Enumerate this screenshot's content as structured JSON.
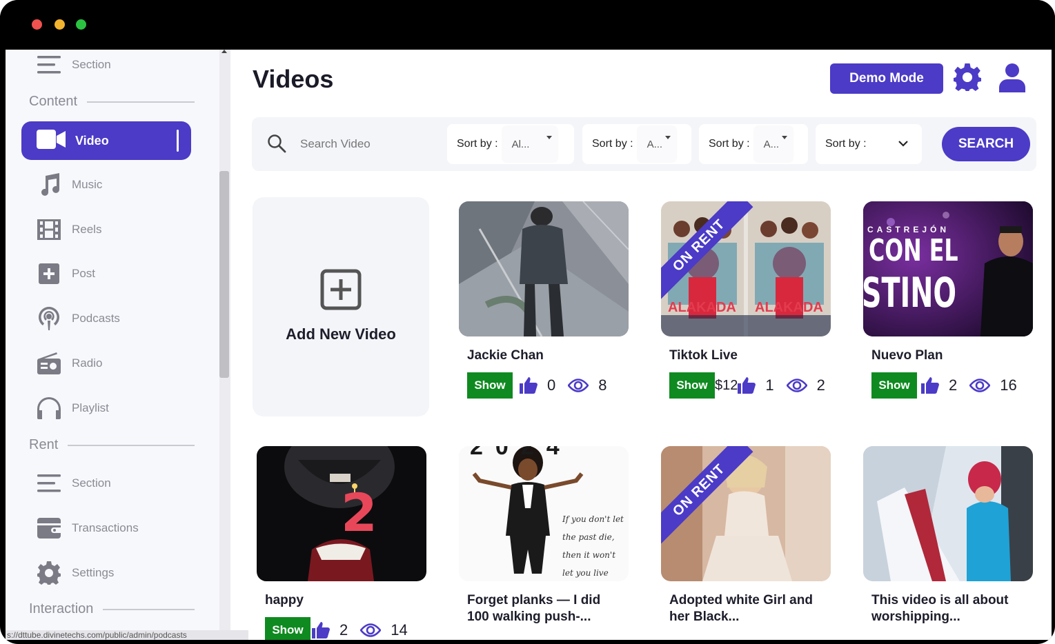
{
  "window": {
    "traffic_lights": [
      "close",
      "minimize",
      "zoom"
    ]
  },
  "colors": {
    "accent": "#4b3bc7",
    "show": "#0f8a20",
    "frame": "#000000"
  },
  "sidebar": {
    "top_item": {
      "label": "Section",
      "icon": "menu-icon"
    },
    "groups": [
      {
        "title": "Content"
      },
      {
        "title": "Rent"
      },
      {
        "title": "Interaction"
      }
    ],
    "content_items": [
      {
        "label": "Video",
        "icon": "video-camera-icon",
        "active": true
      },
      {
        "label": "Music",
        "icon": "music-note-icon"
      },
      {
        "label": "Reels",
        "icon": "film-icon"
      },
      {
        "label": "Post",
        "icon": "plus-square-icon"
      },
      {
        "label": "Podcasts",
        "icon": "podcast-icon"
      },
      {
        "label": "Radio",
        "icon": "radio-icon"
      },
      {
        "label": "Playlist",
        "icon": "headphones-icon"
      }
    ],
    "rent_items": [
      {
        "label": "Section",
        "icon": "menu-icon"
      },
      {
        "label": "Transactions",
        "icon": "wallet-icon"
      },
      {
        "label": "Settings",
        "icon": "gear-icon"
      }
    ]
  },
  "status_url": "s://dttube.divinetechs.com/public/admin/podcasts",
  "header": {
    "title": "Videos",
    "demo_label": "Demo Mode"
  },
  "filters": {
    "search_placeholder": "Search Video",
    "sorts": [
      {
        "label": "Sort by :",
        "value": "Al..."
      },
      {
        "label": "Sort by :",
        "value": "A..."
      },
      {
        "label": "Sort by :",
        "value": "A..."
      },
      {
        "label": "Sort by :",
        "value": ""
      }
    ],
    "search_button": "SEARCH"
  },
  "add_card": {
    "label": "Add New Video"
  },
  "videos": [
    {
      "title": "Jackie Chan",
      "show": "Show",
      "price": "",
      "likes": "0",
      "views": "8",
      "on_rent": false
    },
    {
      "title": "Tiktok Live",
      "show": "Show",
      "price": "$12",
      "likes": "1",
      "views": "2",
      "on_rent": true,
      "ribbon": "ON RENT"
    },
    {
      "title": "Nuevo Plan",
      "show": "Show",
      "price": "",
      "likes": "2",
      "views": "16",
      "on_rent": false,
      "thumb_text_1": "CASTREJÓN",
      "thumb_text_2": "CON EL",
      "thumb_text_3": "STINO"
    },
    {
      "title": "happy",
      "show": "Show",
      "price": "",
      "likes": "2",
      "views": "14",
      "on_rent": false,
      "thumb_text_1": "2"
    },
    {
      "title": "Forget planks — I did 100 walking push-...",
      "show": "",
      "on_rent": false,
      "thumb_text_1": "2024"
    },
    {
      "title": "Adopted white Girl and her Black...",
      "show": "",
      "on_rent": true,
      "ribbon": "ON RENT"
    },
    {
      "title": "This video is all about worshipping...",
      "show": "",
      "on_rent": false
    }
  ]
}
